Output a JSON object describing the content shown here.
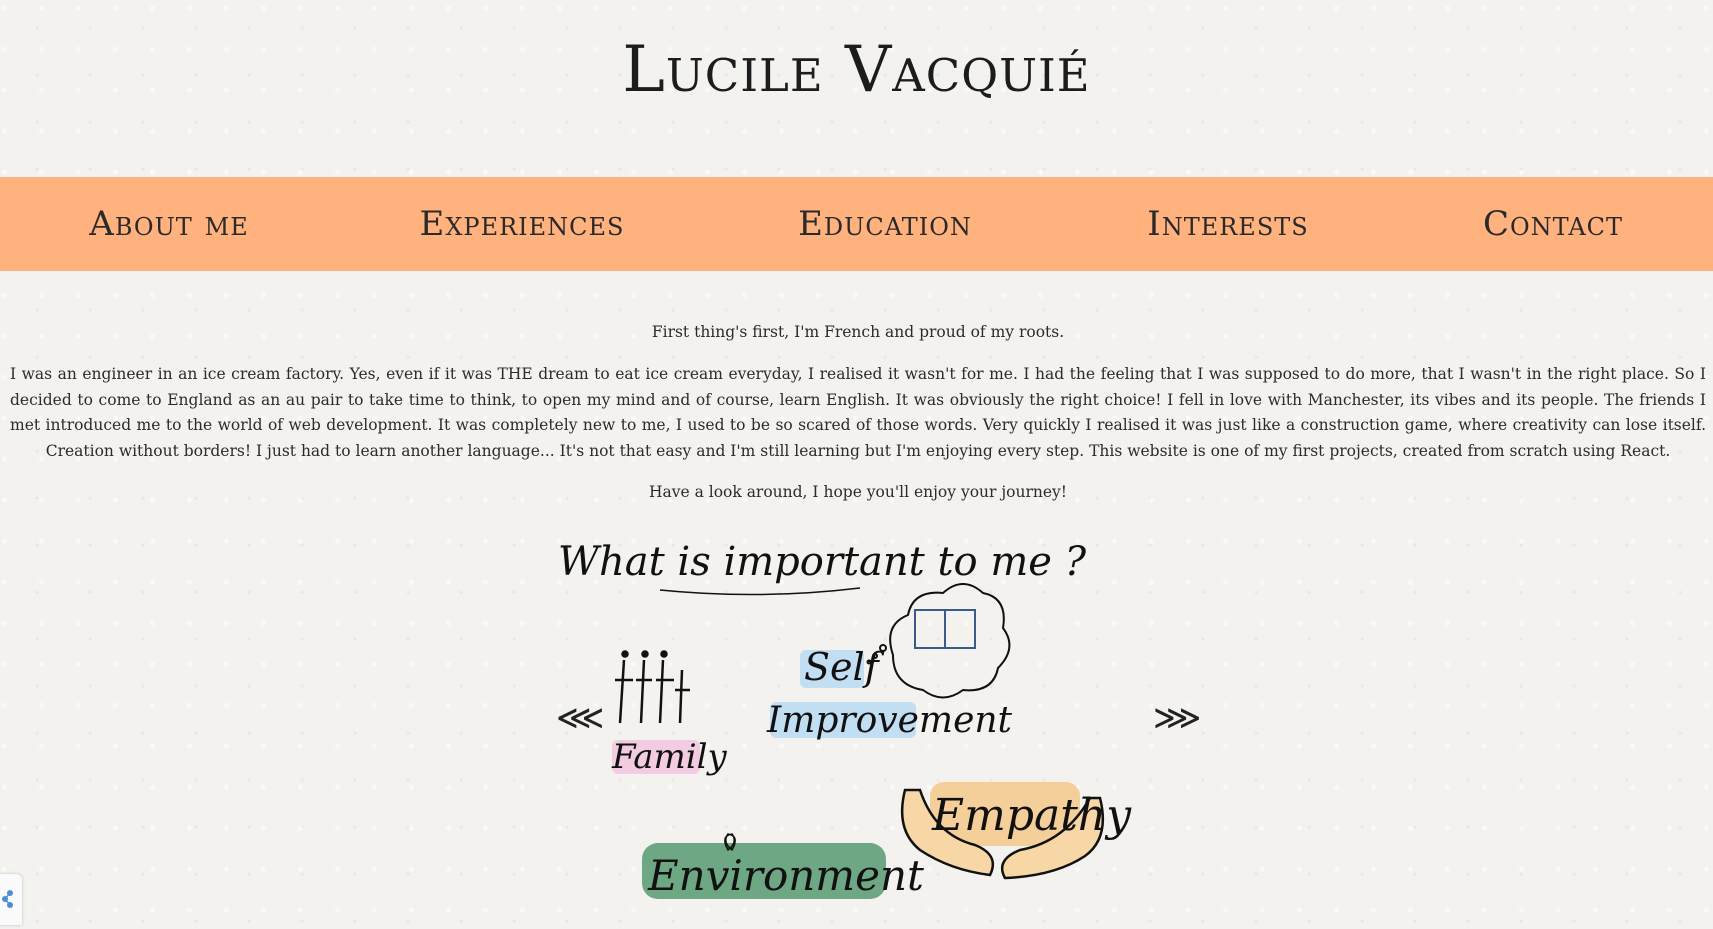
{
  "header": {
    "title": "Lucile Vacquié"
  },
  "nav": {
    "items": [
      {
        "label": "About me"
      },
      {
        "label": "Experiences"
      },
      {
        "label": "Education"
      },
      {
        "label": "Interests"
      },
      {
        "label": "Contact"
      }
    ],
    "colors": {
      "background": "#ffb27e"
    }
  },
  "intro": {
    "p1": "First thing's first, I'm French and proud of my roots.",
    "p2": "I was an engineer in an ice cream factory. Yes, even if it was THE dream to eat ice cream everyday, I realised it wasn't for me. I had the feeling that I was supposed to do more, that I wasn't in the right place. So I decided to come to England as an au pair to take time to think, to open my mind and of course, learn English. It was obviously the right choice! I fell in love with Manchester, its vibes and its people. The friends I met introduced me to the world of web development. It was completely new to me, I used to be so scared of those words. Very quickly I realised it was just like a construction game, where creativity can lose itself. Creation without borders! I just had to learn another language... It's not that easy and I'm still learning but I'm enjoying every step. This website is one of my first projects, created from scratch using React.",
    "p3": "Have a look around, I hope you'll enjoy your journey!"
  },
  "carousel": {
    "heading": "What is important to me ?",
    "prev_icon": "chevron-double-left-icon",
    "next_icon": "chevron-double-right-icon",
    "prev_glyph": "⋘",
    "next_glyph": "⋙",
    "words": {
      "family": "Family",
      "self": "Self",
      "improvement": "Improvement",
      "empathy": "Empathy",
      "environment": "Environment"
    },
    "colors": {
      "family": "#f2c6de",
      "self": "#bcdcf2",
      "empathy": "#f5c98a",
      "environment": "#5f9e78"
    }
  },
  "share": {
    "icon": "share-icon"
  }
}
